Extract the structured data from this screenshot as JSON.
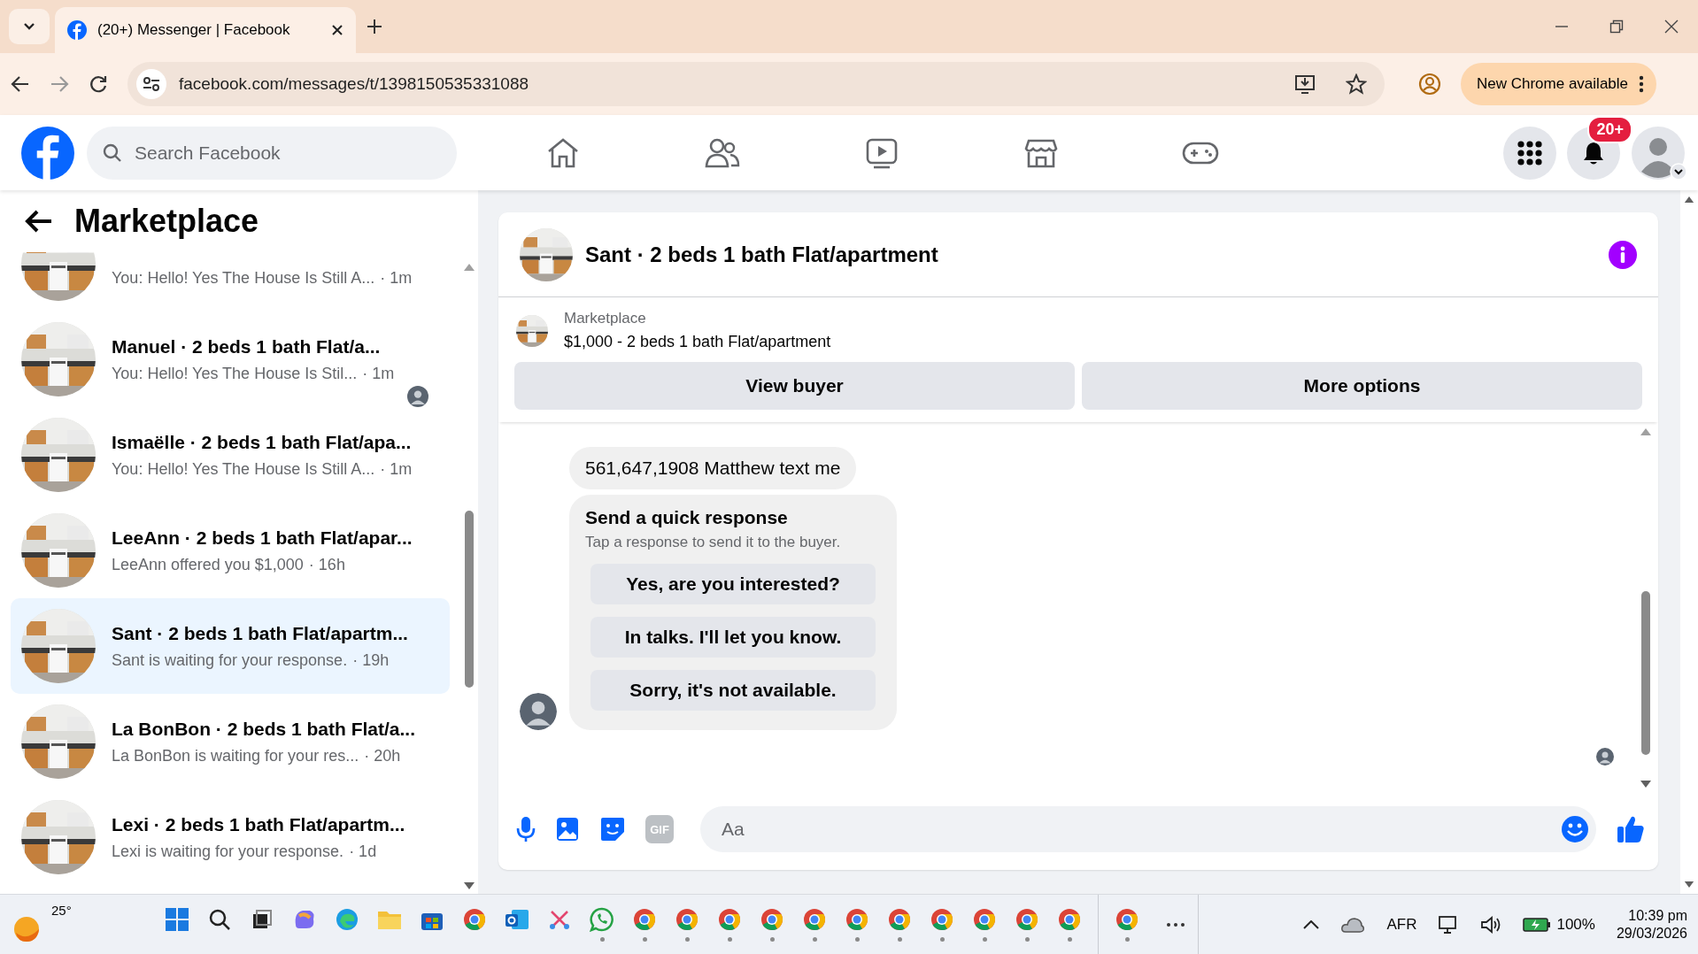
{
  "browser": {
    "tabs": [
      {
        "title": "(20+) Messenger | Facebook",
        "selected": true
      }
    ],
    "url": "facebook.com/messages/t/1398150535331088",
    "update_button": "New Chrome available"
  },
  "facebook_header": {
    "search": {
      "placeholder": "Search Facebook"
    },
    "nav": [
      {
        "kind": "home"
      },
      {
        "kind": "friends"
      },
      {
        "kind": "video"
      },
      {
        "kind": "marketplace"
      },
      {
        "kind": "gaming"
      }
    ],
    "notification_badge": "20+"
  },
  "sidebar": {
    "title": "Marketplace",
    "conversations": [
      {
        "preview": "You: Hello! Yes The House Is Still A...",
        "time": "· 1m",
        "selected": false,
        "seen": false
      },
      {
        "title": "Manuel · 2 beds 1 bath Flat/a...",
        "preview": "You: Hello! Yes The House Is Stil...",
        "time": "· 1m",
        "selected": false,
        "seen": true
      },
      {
        "title": "Ismaëlle · 2 beds 1 bath Flat/apa...",
        "preview": "You: Hello! Yes The House Is Still A...",
        "time": "· 1m",
        "selected": false,
        "seen": false
      },
      {
        "title": "LeeAnn · 2 beds 1 bath Flat/apar...",
        "preview": "LeeAnn offered you $1,000",
        "time": "· 16h",
        "selected": false,
        "seen": false
      },
      {
        "title": "Sant · 2 beds 1 bath Flat/apartm...",
        "preview": "Sant is waiting for your response.",
        "time": "· 19h",
        "selected": true,
        "seen": false
      },
      {
        "title": "La BonBon · 2 beds 1 bath Flat/a...",
        "preview": "La BonBon is waiting for your res...",
        "time": "· 20h",
        "selected": false,
        "seen": false
      },
      {
        "title": "Lexi · 2 beds 1 bath Flat/apartm...",
        "preview": "Lexi is waiting for your response.",
        "time": "· 1d",
        "selected": false,
        "seen": false
      }
    ]
  },
  "chat": {
    "title": "Sant · 2 beds 1 bath Flat/apartment",
    "listing": {
      "label": "Marketplace",
      "price_title": "$1,000 - 2 beds 1 bath Flat/apartment"
    },
    "actions": [
      "View buyer",
      "More options"
    ],
    "messages": [
      {
        "kind": "text",
        "text": "561,647,1908 Matthew text me"
      },
      {
        "kind": "quick_responses",
        "title": "Send a quick response",
        "subtitle": "Tap a response to send it to the buyer.",
        "options": [
          "Yes, are you interested?",
          "In talks. I'll let you know.",
          "Sorry, it's not available."
        ]
      }
    ],
    "composer": {
      "placeholder": "Aa",
      "gif_label": "GIF"
    }
  },
  "taskbar": {
    "weather": "25°",
    "apps": [
      {
        "kind": "start",
        "running": false
      },
      {
        "kind": "search",
        "running": false
      },
      {
        "kind": "task-view",
        "running": false
      },
      {
        "kind": "copilot",
        "running": false
      },
      {
        "kind": "edge",
        "running": false
      },
      {
        "kind": "files",
        "running": false
      },
      {
        "kind": "store",
        "running": false
      },
      {
        "kind": "chrome",
        "running": false
      },
      {
        "kind": "outlook",
        "running": false
      },
      {
        "kind": "snipping",
        "running": false
      },
      {
        "kind": "whatsapp",
        "running": true
      },
      {
        "kind": "chrome",
        "running": true
      },
      {
        "kind": "chrome",
        "running": true
      },
      {
        "kind": "chrome",
        "running": true
      },
      {
        "kind": "chrome",
        "running": true
      },
      {
        "kind": "chrome",
        "running": true
      },
      {
        "kind": "chrome",
        "running": true
      },
      {
        "kind": "chrome",
        "running": true
      },
      {
        "kind": "chrome",
        "running": true
      },
      {
        "kind": "chrome",
        "running": true
      },
      {
        "kind": "chrome",
        "running": true
      },
      {
        "kind": "chrome",
        "running": true
      }
    ],
    "pinned_group": [
      {
        "kind": "chrome",
        "running": true
      }
    ],
    "tray": {
      "language": "AFR",
      "battery": "100%",
      "time": "10:39 pm",
      "date": "29/03/2026"
    }
  }
}
